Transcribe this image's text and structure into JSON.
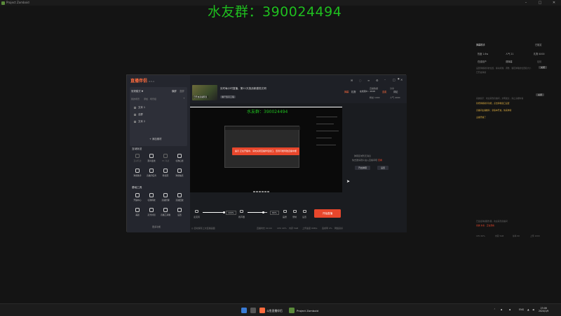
{
  "window": {
    "title": "Project Zomboid"
  },
  "banner": "水友群：390024494",
  "right_panel": {
    "title": "弹幕助手",
    "settings": "已锁定",
    "stats": [
      "热度 1.6w",
      "人气 21",
      "礼物 4000"
    ],
    "tabs": [
      "在线用户",
      "调弹幕",
      "贴纸"
    ],
    "line1": "设置弹幕助手的位置，拖动标题，调整、锁定弹幕的位置和大小",
    "line2": "已开启弹幕",
    "note1": "系统提示：欢迎来到直播间，文明发言，禁止违规内容",
    "note_hi1": "新增弹幕助手功能，点击弹幕窗口设置",
    "note_hi2": "直播间主播推荐：新版本开启，快来体验",
    "note_hi3": "主播开播了",
    "btn_close": "关闭",
    "bottom1": "已连接弹幕服务器，欢迎来到直播间",
    "bottom_user": "系统 水友 · 正在观看",
    "perf": [
      "CPU 40%",
      "内存 5GB",
      "帧率 60",
      "上传 1000"
    ]
  },
  "app": {
    "logo": "直播伴侣",
    "version": "6.5.4",
    "scene_mode": "常规模式 ▼",
    "scene_tabs": [
      "横屏",
      "竖屏"
    ],
    "scene_label": "我的场景",
    "scene_actions": "添加 · 场景组",
    "sources": [
      "文本 1",
      "全屏",
      "文本 2"
    ],
    "add_source": "+ 添加素材",
    "sec_interactive": "互动玩法",
    "interactive_tools": [
      {
        "label": "互动玩法",
        "enabled": false
      },
      {
        "label": "观众连线",
        "enabled": true
      },
      {
        "label": "PK 对战",
        "enabled": false
      },
      {
        "label": "礼物心愿",
        "enabled": true
      },
      {
        "label": "弹幕助手",
        "enabled": true
      },
      {
        "label": "直播间任务",
        "enabled": true
      },
      {
        "label": "粉丝团",
        "enabled": true
      },
      {
        "label": "弹幕抽奖",
        "enabled": true
      }
    ],
    "sec_tools": "基础工具",
    "basic_tools": [
      {
        "label": "开播中心",
        "enabled": true
      },
      {
        "label": "礼物特效",
        "enabled": true
      },
      {
        "label": "直播管理",
        "enabled": true
      },
      {
        "label": "直播回放",
        "enabled": true
      },
      {
        "label": "美颜",
        "enabled": true
      },
      {
        "label": "高光时刻",
        "enabled": true
      },
      {
        "label": "直播工具箱",
        "enabled": true
      },
      {
        "label": "设置",
        "enabled": true
      }
    ],
    "more": "更多功能",
    "room_title": "实时每小时直播，第11天挑战新建档文明",
    "room_tag": "僵尸毁灭工程",
    "thumb_tag": "已开启直播预览",
    "top_stats": [
      "直播数据",
      "分享",
      "粉丝 1000",
      "人气 4000"
    ],
    "preview": {
      "banner": "水友群：390024494",
      "alert": "提示 正在开播中，请勿关闭直播伴侣窗口，否则可能导致直播中断"
    },
    "chat": {
      "tabs": [
        "弹幕",
        "礼物",
        "在线观众 • 2048",
        "连麦",
        "评论"
      ],
      "empty1": "弹幕区域暂无消息",
      "empty2": "快去邀请观众进入直播间吧",
      "link": "查看",
      "btn_left": "开启弹幕",
      "btn_right": "设置"
    },
    "controls": {
      "mic_label": "麦克风",
      "mic_value": "100%",
      "speaker_label": "扬声器",
      "speaker_value": "80%",
      "mic_fraction": 1.0,
      "speaker_fraction": 0.8,
      "cam_label": "画质",
      "record_label": "录制",
      "setting_label": "设置"
    },
    "start_button": "开始直播",
    "status_left": "◎ 自动保存上次直播画面",
    "status_items": [
      "直播时长 00:00",
      "CPU 40%",
      "内存 5GB",
      "上传速度 0KB/s",
      "丢帧率 0%",
      "网络良好"
    ]
  },
  "taskbar": {
    "items": [
      "斗鱼直播伴侣",
      "Project Zomboid"
    ],
    "tray": [
      "ENG"
    ],
    "time": "23:06",
    "date": "2024/1/9"
  },
  "colors": {
    "accent": "#e8472c",
    "banner": "#1fbf1f"
  }
}
